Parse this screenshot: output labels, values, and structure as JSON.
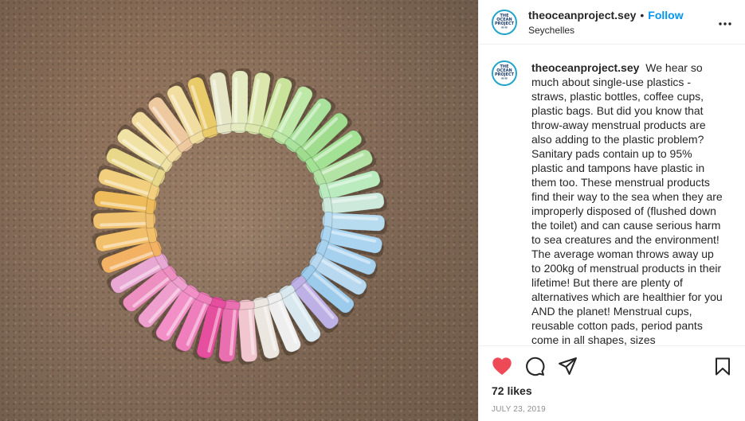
{
  "post": {
    "username": "theoceanproject.sey",
    "follow_label": "Follow",
    "separator": "•",
    "location": "Seychelles",
    "more_label": "•••",
    "caption": "We hear so much about single-use plastics - straws, plastic bottles, coffee cups, plastic bags. But did you know that throw-away menstrual products are also adding to the plastic problem? Sanitary pads contain up to 95% plastic and tampons have plastic in them too. These menstrual products find their way to the sea when they are improperly disposed of (flushed down the toilet) and can cause serious harm to sea creatures and the environment! The average woman throws away up to 200kg of menstrual products in their lifetime! But there are plenty of alternatives which are healthier for you AND the planet! Menstrual cups, reusable cotton pads, period pants come in all shapes, sizes",
    "likes": "72 likes",
    "date": "JULY 23, 2019"
  },
  "icons": {
    "avatar": "ocean-project-logo",
    "like": "heart-icon",
    "comment": "comment-bubble-icon",
    "share": "paper-plane-icon",
    "save": "bookmark-icon"
  },
  "colors": {
    "like_red": "#ed4956",
    "follow_blue": "#0095f6",
    "applicators": [
      "#f0e2a4",
      "#f3dca0",
      "#eec9a0",
      "#f1dda0",
      "#eacb6a",
      "#e6e6c7",
      "#e4ebc0",
      "#dbe7ad",
      "#c9e39a",
      "#bde8a7",
      "#a8e29c",
      "#9fdc8e",
      "#a3e194",
      "#b3e3a4",
      "#b9ebbf",
      "#cde9dc",
      "#b8dcef",
      "#aad4f0",
      "#a5d0ee",
      "#b7d8ee",
      "#9ccbec",
      "#bdb0e4",
      "#d8e8ee",
      "#eeeeee",
      "#ece6e0",
      "#f1c6cf",
      "#e96fb0",
      "#e64e9e",
      "#ee7fbc",
      "#f18fc6",
      "#ee9fcd",
      "#ee8fc1",
      "#e9a8d4",
      "#f3b164",
      "#f2c06b",
      "#f0c16f",
      "#eebc5a",
      "#f1cf7e",
      "#e9d78a"
    ]
  }
}
